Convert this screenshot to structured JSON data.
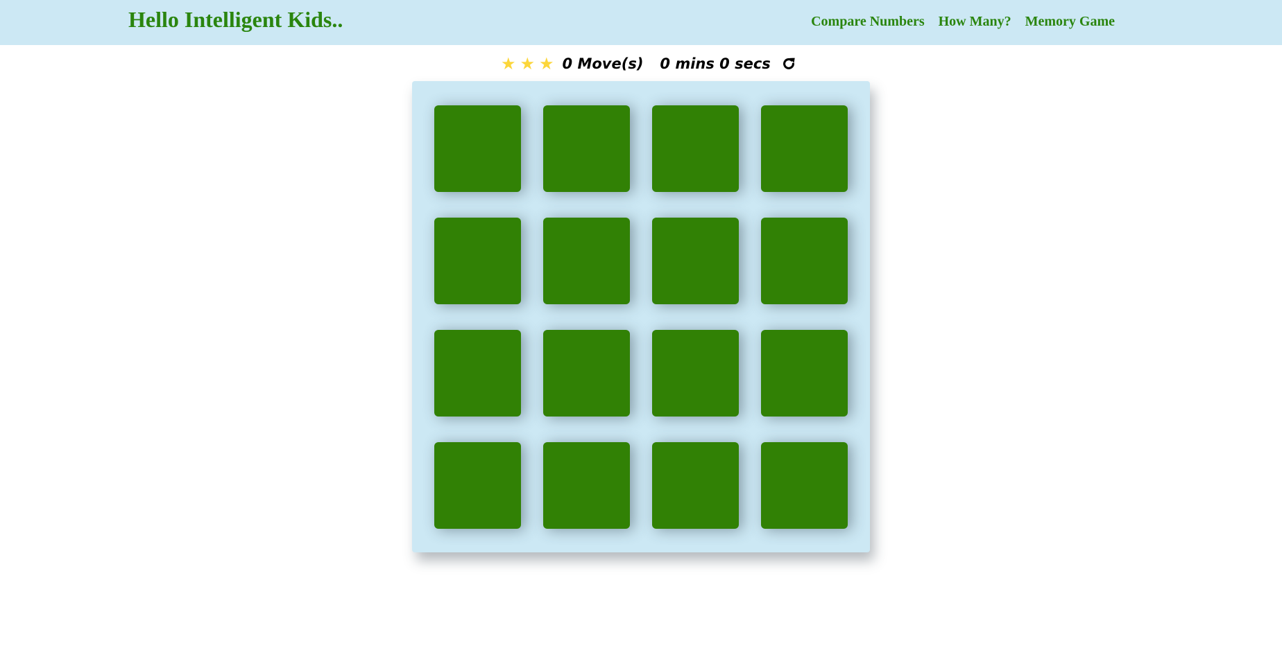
{
  "navbar": {
    "brand": "Hello Intelligent Kids..",
    "links": [
      "Compare Numbers",
      "How Many?",
      "Memory Game"
    ]
  },
  "score_panel": {
    "stars": 3,
    "moves": "0 Move(s)",
    "timer": "0 mins 0 secs",
    "restart_icon": "repeat-icon"
  },
  "deck": {
    "rows": 4,
    "columns": 4,
    "card_state": "face-down"
  },
  "colors": {
    "navbar_bg": "#cce8f4",
    "brand_green": "#2a850e",
    "card_green": "#318105",
    "star_yellow": "#fcd63a"
  }
}
